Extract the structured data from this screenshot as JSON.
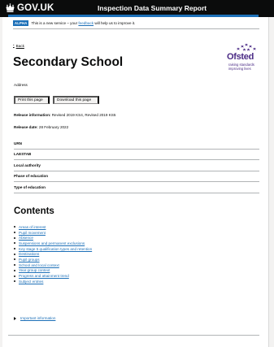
{
  "header": {
    "logo_text": "GOV.UK",
    "service_name": "Inspection Data Summary Report"
  },
  "phase_banner": {
    "tag": "ALPHA",
    "text_before": "This is a new service – your",
    "link_text": "feedback",
    "text_after": "will help us to improve it."
  },
  "back_link": "Back",
  "page_title": "Secondary School",
  "ofsted_logo": {
    "wordmark": "Ofsted",
    "tagline_line1": "raising standards",
    "tagline_line2": "improving lives"
  },
  "address_label": "Address",
  "buttons": {
    "print": "Print this page",
    "download": "Download this page"
  },
  "release_info": {
    "label": "Release information:",
    "value": "Revised 2019 KS4, Revised 2019 KS5"
  },
  "release_date": {
    "label": "Release date:",
    "value": "28 February 2022"
  },
  "summary_rows": [
    "URN",
    "LAESTAB",
    "Local authority",
    "Phase of education",
    "Type of education"
  ],
  "contents": {
    "title": "Contents",
    "items": [
      "Areas of interest",
      "Pupil movement",
      "Absence",
      "Suspensions and permanent exclusions",
      "Key stage 5 qualification types and retention",
      "Destinations",
      "Pupil groups",
      "School and local context",
      "Year group context",
      "Progress and attainment trend",
      "Subject entries"
    ]
  },
  "details_summary": "Important information",
  "colors": {
    "header_bg": "#0b0c0c",
    "accent_blue": "#1d70b8",
    "link": "#1d70b8",
    "ofsted_purple": "#4a2a85"
  }
}
